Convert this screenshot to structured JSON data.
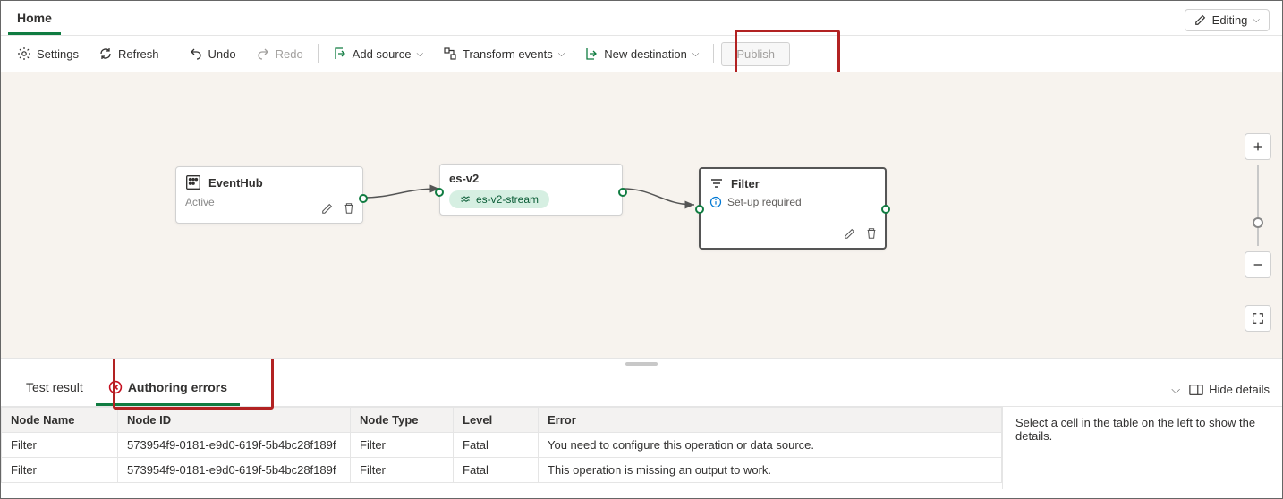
{
  "header": {
    "tab_home": "Home",
    "editing_label": "Editing"
  },
  "toolbar": {
    "settings": "Settings",
    "refresh": "Refresh",
    "undo": "Undo",
    "redo": "Redo",
    "add_source": "Add source",
    "transform_events": "Transform events",
    "new_destination": "New destination",
    "publish": "Publish"
  },
  "nodes": {
    "eventhub": {
      "title": "EventHub",
      "status": "Active"
    },
    "esv2": {
      "title": "es-v2",
      "stream_chip": "es-v2-stream"
    },
    "filter": {
      "title": "Filter",
      "info": "Set-up required"
    }
  },
  "panel": {
    "tab_test": "Test result",
    "tab_errors": "Authoring errors",
    "hide_details": "Hide details",
    "hint": "Select a cell in the table on the left to show the details."
  },
  "errors": {
    "columns": {
      "node_name": "Node Name",
      "node_id": "Node ID",
      "node_type": "Node Type",
      "level": "Level",
      "error": "Error"
    },
    "rows": [
      {
        "node_name": "Filter",
        "node_id": "573954f9-0181-e9d0-619f-5b4bc28f189f",
        "node_type": "Filter",
        "level": "Fatal",
        "error": "You need to configure this operation or data source."
      },
      {
        "node_name": "Filter",
        "node_id": "573954f9-0181-e9d0-619f-5b4bc28f189f",
        "node_type": "Filter",
        "level": "Fatal",
        "error": "This operation is missing an output to work."
      }
    ]
  }
}
